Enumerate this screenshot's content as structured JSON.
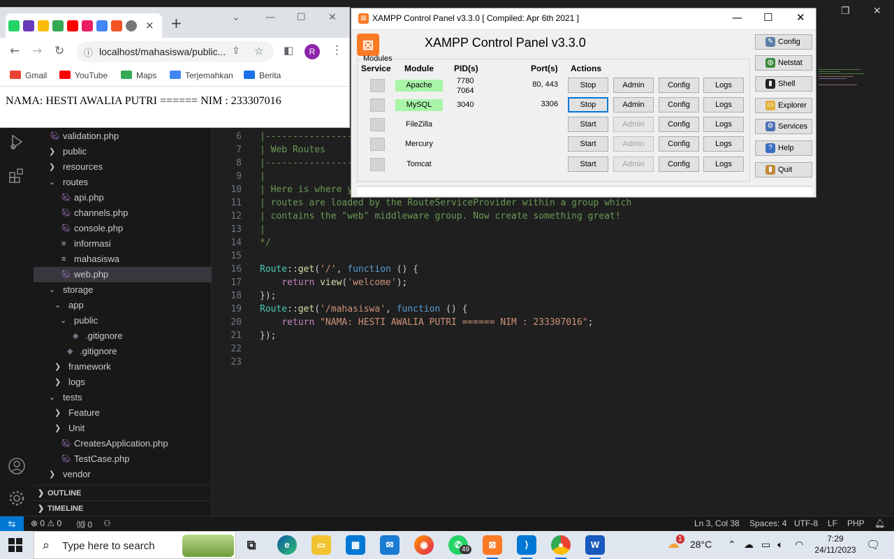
{
  "browser": {
    "tab_close_glyph": "×",
    "new_tab_glyph": "+",
    "address": "localhost/mahasiswa/public...",
    "profile_initial": "R",
    "bookmarks": [
      {
        "label": "Gmail",
        "color": "#ea4335"
      },
      {
        "label": "YouTube",
        "color": "#ff0000"
      },
      {
        "label": "Maps",
        "color": "#34a853"
      },
      {
        "label": "Terjemahkan",
        "color": "#4285f4"
      },
      {
        "label": "Berita",
        "color": "#1a73e8"
      }
    ],
    "page_text": "NAMA: HESTI AWALIA PUTRI ====== NIM : 233307016"
  },
  "xampp": {
    "window_title": "XAMPP Control Panel v3.3.0   [ Compiled: Apr 6th 2021 ]",
    "heading": "XAMPP Control Panel v3.3.0",
    "modules_label": "Modules",
    "headers": {
      "service": "Service",
      "module": "Module",
      "pid": "PID(s)",
      "port": "Port(s)",
      "actions": "Actions"
    },
    "rows": [
      {
        "module": "Apache",
        "pid": "7780\n7064",
        "port": "80, 443",
        "action": "Stop",
        "admin": "Admin",
        "config": "Config",
        "logs": "Logs",
        "running": true
      },
      {
        "module": "MySQL",
        "pid": "3040",
        "port": "3306",
        "action": "Stop",
        "admin": "Admin",
        "config": "Config",
        "logs": "Logs",
        "running": true
      },
      {
        "module": "FileZilla",
        "pid": "",
        "port": "",
        "action": "Start",
        "admin": "Admin",
        "config": "Config",
        "logs": "Logs",
        "running": false
      },
      {
        "module": "Mercury",
        "pid": "",
        "port": "",
        "action": "Start",
        "admin": "Admin",
        "config": "Config",
        "logs": "Logs",
        "running": false
      },
      {
        "module": "Tomcat",
        "pid": "",
        "port": "",
        "action": "Start",
        "admin": "Admin",
        "config": "Config",
        "logs": "Logs",
        "running": false
      }
    ],
    "side_buttons": [
      {
        "label": "Config",
        "icon": "wrench-icon",
        "color": "#5b7fa8"
      },
      {
        "label": "Netstat",
        "icon": "globe-icon",
        "color": "#3a8a3a"
      },
      {
        "label": "Shell",
        "icon": "terminal-icon",
        "color": "#222222"
      },
      {
        "label": "Explorer",
        "icon": "folder-icon",
        "color": "#e0b03a"
      },
      {
        "label": "Services",
        "icon": "services-icon",
        "color": "#4a6fb0"
      },
      {
        "label": "Help",
        "icon": "help-icon",
        "color": "#3a70c0"
      },
      {
        "label": "Quit",
        "icon": "quit-icon",
        "color": "#c08a3a"
      }
    ]
  },
  "explorer": {
    "items": [
      {
        "label": "validation.php",
        "type": "php"
      },
      {
        "label": "public",
        "type": "folder"
      },
      {
        "label": "resources",
        "type": "folder"
      },
      {
        "label": "routes",
        "type": "folder-open"
      },
      {
        "label": "api.php",
        "type": "php"
      },
      {
        "label": "channels.php",
        "type": "php"
      },
      {
        "label": "console.php",
        "type": "php"
      },
      {
        "label": "informasi",
        "type": "txt"
      },
      {
        "label": "mahasiswa",
        "type": "txt"
      },
      {
        "label": "web.php",
        "type": "php",
        "active": true
      },
      {
        "label": "storage",
        "type": "folder-open"
      },
      {
        "label": "app",
        "type": "folder-open"
      },
      {
        "label": "public",
        "type": "folder-open"
      },
      {
        "label": ".gitignore",
        "type": "git"
      },
      {
        "label": ".gitignore",
        "type": "git"
      },
      {
        "label": "framework",
        "type": "folder"
      },
      {
        "label": "logs",
        "type": "folder"
      },
      {
        "label": "tests",
        "type": "folder-open"
      },
      {
        "label": "Feature",
        "type": "folder"
      },
      {
        "label": "Unit",
        "type": "folder"
      },
      {
        "label": "CreatesApplication.php",
        "type": "php"
      },
      {
        "label": "TestCase.php",
        "type": "php"
      },
      {
        "label": "vendor",
        "type": "folder"
      }
    ],
    "outline": "OUTLINE",
    "timeline": "TIMELINE"
  },
  "editor": {
    "lines": [
      {
        "n": "6",
        "text": "|--------------------------------------------------------------------------"
      },
      {
        "n": "7",
        "text": "| Web Routes"
      },
      {
        "n": "8",
        "text": "|--------------------------------------------------------------------------"
      },
      {
        "n": "9",
        "text": "|"
      },
      {
        "n": "10",
        "text": "| Here is where you can register web routes for your application. These"
      },
      {
        "n": "11",
        "text": "| routes are loaded by the RouteServiceProvider within a group which"
      },
      {
        "n": "12",
        "text": "| contains the \"web\" middleware group. Now create something great!"
      },
      {
        "n": "13",
        "text": "|"
      },
      {
        "n": "14",
        "text": "*/"
      },
      {
        "n": "15",
        "text": ""
      },
      {
        "n": "16",
        "text": "Route::get('/', function () {"
      },
      {
        "n": "17",
        "text": "    return view('welcome');"
      },
      {
        "n": "18",
        "text": "});"
      },
      {
        "n": "19",
        "text": "Route::get('/mahasiswa', function () {"
      },
      {
        "n": "20",
        "text": "    return \"NAMA: HESTI AWALIA PUTRI ====== NIM : 233307016\";"
      },
      {
        "n": "21",
        "text": "});"
      },
      {
        "n": "22",
        "text": ""
      },
      {
        "n": "23",
        "text": ""
      }
    ]
  },
  "statusbar": {
    "problems": "⊗ 0 ⚠ 0",
    "ports": "⑽ 0",
    "position": "Ln 3, Col 38",
    "spaces": "Spaces: 4",
    "encoding": "UTF-8",
    "eol": "LF",
    "language": "PHP"
  },
  "taskbar": {
    "search_placeholder": "Type here to search",
    "whatsapp_badge": "49",
    "weather_badge": "1",
    "temperature": "28°C",
    "time": "7:29",
    "date": "24/11/2023"
  }
}
